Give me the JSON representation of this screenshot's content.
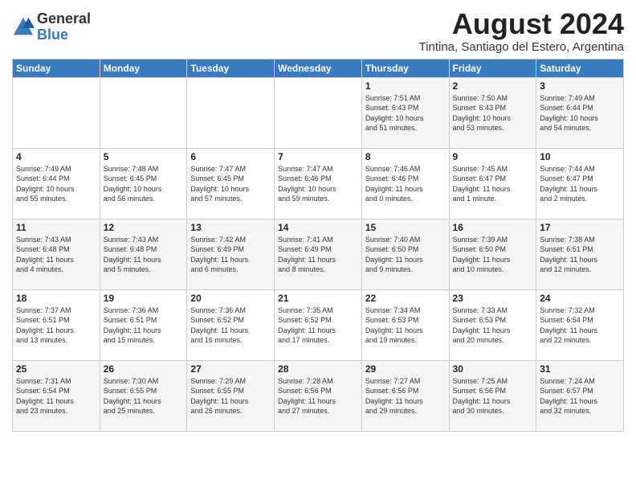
{
  "logo": {
    "general": "General",
    "blue": "Blue"
  },
  "title": {
    "month_year": "August 2024",
    "location": "Tintina, Santiago del Estero, Argentina"
  },
  "weekdays": [
    "Sunday",
    "Monday",
    "Tuesday",
    "Wednesday",
    "Thursday",
    "Friday",
    "Saturday"
  ],
  "weeks": [
    [
      {
        "day": "",
        "info": ""
      },
      {
        "day": "",
        "info": ""
      },
      {
        "day": "",
        "info": ""
      },
      {
        "day": "",
        "info": ""
      },
      {
        "day": "1",
        "info": "Sunrise: 7:51 AM\nSunset: 6:43 PM\nDaylight: 10 hours\nand 51 minutes."
      },
      {
        "day": "2",
        "info": "Sunrise: 7:50 AM\nSunset: 6:43 PM\nDaylight: 10 hours\nand 53 minutes."
      },
      {
        "day": "3",
        "info": "Sunrise: 7:49 AM\nSunset: 6:44 PM\nDaylight: 10 hours\nand 54 minutes."
      }
    ],
    [
      {
        "day": "4",
        "info": "Sunrise: 7:49 AM\nSunset: 6:44 PM\nDaylight: 10 hours\nand 55 minutes."
      },
      {
        "day": "5",
        "info": "Sunrise: 7:48 AM\nSunset: 6:45 PM\nDaylight: 10 hours\nand 56 minutes."
      },
      {
        "day": "6",
        "info": "Sunrise: 7:47 AM\nSunset: 6:45 PM\nDaylight: 10 hours\nand 57 minutes."
      },
      {
        "day": "7",
        "info": "Sunrise: 7:47 AM\nSunset: 6:46 PM\nDaylight: 10 hours\nand 59 minutes."
      },
      {
        "day": "8",
        "info": "Sunrise: 7:46 AM\nSunset: 6:46 PM\nDaylight: 11 hours\nand 0 minutes."
      },
      {
        "day": "9",
        "info": "Sunrise: 7:45 AM\nSunset: 6:47 PM\nDaylight: 11 hours\nand 1 minute."
      },
      {
        "day": "10",
        "info": "Sunrise: 7:44 AM\nSunset: 6:47 PM\nDaylight: 11 hours\nand 2 minutes."
      }
    ],
    [
      {
        "day": "11",
        "info": "Sunrise: 7:43 AM\nSunset: 6:48 PM\nDaylight: 11 hours\nand 4 minutes."
      },
      {
        "day": "12",
        "info": "Sunrise: 7:43 AM\nSunset: 6:48 PM\nDaylight: 11 hours\nand 5 minutes."
      },
      {
        "day": "13",
        "info": "Sunrise: 7:42 AM\nSunset: 6:49 PM\nDaylight: 11 hours\nand 6 minutes."
      },
      {
        "day": "14",
        "info": "Sunrise: 7:41 AM\nSunset: 6:49 PM\nDaylight: 11 hours\nand 8 minutes."
      },
      {
        "day": "15",
        "info": "Sunrise: 7:40 AM\nSunset: 6:50 PM\nDaylight: 11 hours\nand 9 minutes."
      },
      {
        "day": "16",
        "info": "Sunrise: 7:39 AM\nSunset: 6:50 PM\nDaylight: 11 hours\nand 10 minutes."
      },
      {
        "day": "17",
        "info": "Sunrise: 7:38 AM\nSunset: 6:51 PM\nDaylight: 11 hours\nand 12 minutes."
      }
    ],
    [
      {
        "day": "18",
        "info": "Sunrise: 7:37 AM\nSunset: 6:51 PM\nDaylight: 11 hours\nand 13 minutes."
      },
      {
        "day": "19",
        "info": "Sunrise: 7:36 AM\nSunset: 6:51 PM\nDaylight: 11 hours\nand 15 minutes."
      },
      {
        "day": "20",
        "info": "Sunrise: 7:36 AM\nSunset: 6:52 PM\nDaylight: 11 hours\nand 16 minutes."
      },
      {
        "day": "21",
        "info": "Sunrise: 7:35 AM\nSunset: 6:52 PM\nDaylight: 11 hours\nand 17 minutes."
      },
      {
        "day": "22",
        "info": "Sunrise: 7:34 AM\nSunset: 6:53 PM\nDaylight: 11 hours\nand 19 minutes."
      },
      {
        "day": "23",
        "info": "Sunrise: 7:33 AM\nSunset: 6:53 PM\nDaylight: 11 hours\nand 20 minutes."
      },
      {
        "day": "24",
        "info": "Sunrise: 7:32 AM\nSunset: 6:54 PM\nDaylight: 11 hours\nand 22 minutes."
      }
    ],
    [
      {
        "day": "25",
        "info": "Sunrise: 7:31 AM\nSunset: 6:54 PM\nDaylight: 11 hours\nand 23 minutes."
      },
      {
        "day": "26",
        "info": "Sunrise: 7:30 AM\nSunset: 6:55 PM\nDaylight: 11 hours\nand 25 minutes."
      },
      {
        "day": "27",
        "info": "Sunrise: 7:29 AM\nSunset: 6:55 PM\nDaylight: 11 hours\nand 26 minutes."
      },
      {
        "day": "28",
        "info": "Sunrise: 7:28 AM\nSunset: 6:56 PM\nDaylight: 11 hours\nand 27 minutes."
      },
      {
        "day": "29",
        "info": "Sunrise: 7:27 AM\nSunset: 6:56 PM\nDaylight: 11 hours\nand 29 minutes."
      },
      {
        "day": "30",
        "info": "Sunrise: 7:25 AM\nSunset: 6:56 PM\nDaylight: 11 hours\nand 30 minutes."
      },
      {
        "day": "31",
        "info": "Sunrise: 7:24 AM\nSunset: 6:57 PM\nDaylight: 11 hours\nand 32 minutes."
      }
    ]
  ]
}
